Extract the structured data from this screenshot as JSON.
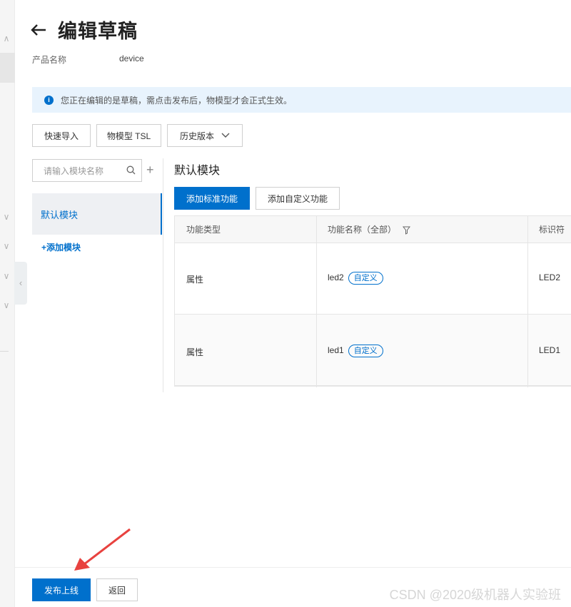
{
  "page": {
    "title": "编辑草稿",
    "back_icon": "arrow-left-icon"
  },
  "product": {
    "label": "产品名称",
    "value": "device"
  },
  "notice": {
    "text": "您正在编辑的是草稿，需点击发布后，物模型才会正式生效。",
    "icon": "info-icon"
  },
  "toolbar": {
    "quick_import": "快速导入",
    "tsl": "物模型 TSL",
    "history": "历史版本"
  },
  "sidebar": {
    "search_placeholder": "请输入模块名称",
    "modules": [
      "默认模块"
    ],
    "add_module": "+添加模块"
  },
  "module": {
    "title": "默认模块",
    "add_standard": "添加标准功能",
    "add_custom": "添加自定义功能"
  },
  "table": {
    "headers": [
      "功能类型",
      "功能名称（全部）",
      "标识符"
    ],
    "rows": [
      {
        "type": "属性",
        "name": "led2",
        "tag": "自定义",
        "identifier": "LED2"
      },
      {
        "type": "属性",
        "name": "led1",
        "tag": "自定义",
        "identifier": "LED1"
      }
    ]
  },
  "footer": {
    "publish": "发布上线",
    "back": "返回"
  },
  "watermark": "CSDN @2020级机器人实验班",
  "colors": {
    "primary": "#0070cc",
    "notice_bg": "#e8f3fd",
    "annotation_arrow": "#e8423f"
  }
}
